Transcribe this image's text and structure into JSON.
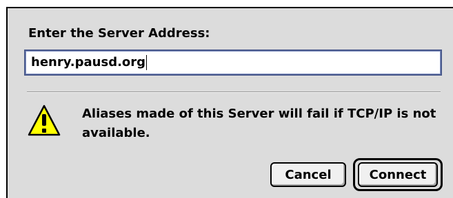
{
  "dialog": {
    "prompt_label": "Enter the Server Address:",
    "server_address_value": "henry.pausd.org",
    "alert_icon": "caution-triangle-icon",
    "alert_message": "Aliases made of this Server will fail if TCP/IP is not available.",
    "buttons": {
      "cancel_label": "Cancel",
      "connect_label": "Connect"
    },
    "default_button": "Connect"
  },
  "colors": {
    "dialog_background": "#dcdcdc",
    "input_focus_ring": "#4a5a8c",
    "caution_fill": "#ffff00"
  }
}
